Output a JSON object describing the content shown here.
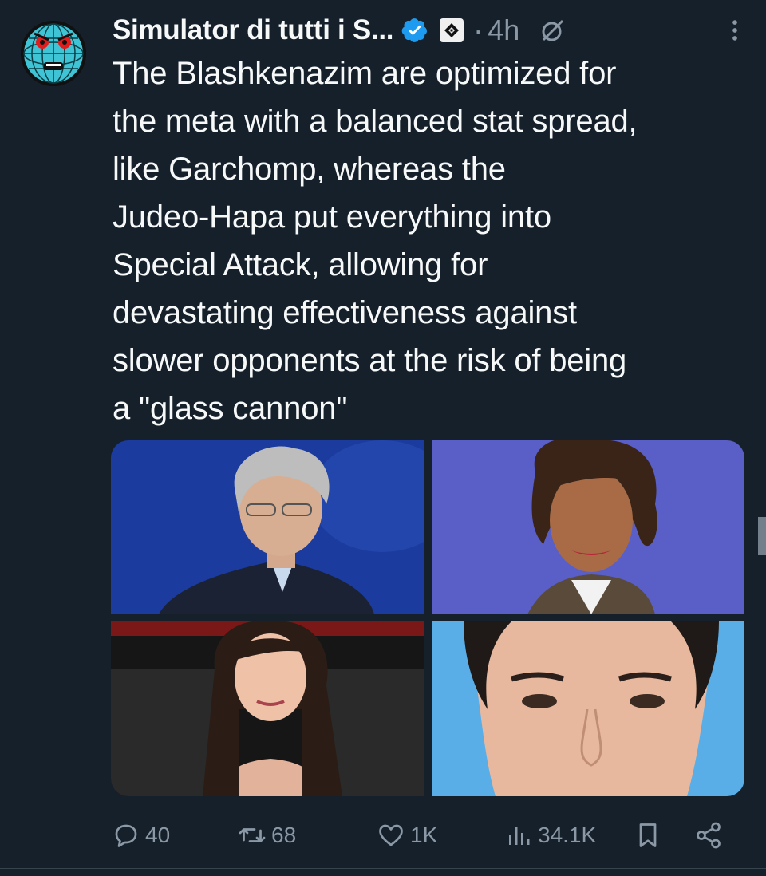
{
  "tweet": {
    "author_name": "Simulator di tutti i S...",
    "time": "4h",
    "separator": "·",
    "text": "The Blashkenazim are optimized for\nthe meta with a balanced stat spread,\nlike Garchomp, whereas the\nJudeo-Hapa put everything into\nSpecial Attack, allowing for\ndevastating effectiveness against\nslower opponents at the risk of being\na \"glass cannon\""
  },
  "media": [
    {
      "icon": "photo"
    },
    {
      "icon": "photo"
    },
    {
      "icon": "photo"
    },
    {
      "icon": "photo"
    }
  ],
  "actions": {
    "replies": "40",
    "reposts": "68",
    "likes": "1K",
    "views": "34.1K"
  },
  "colors": {
    "background": "#15202b",
    "text": "#f7f9f9",
    "muted": "#8b98a5",
    "verified": "#1d9bf0"
  }
}
